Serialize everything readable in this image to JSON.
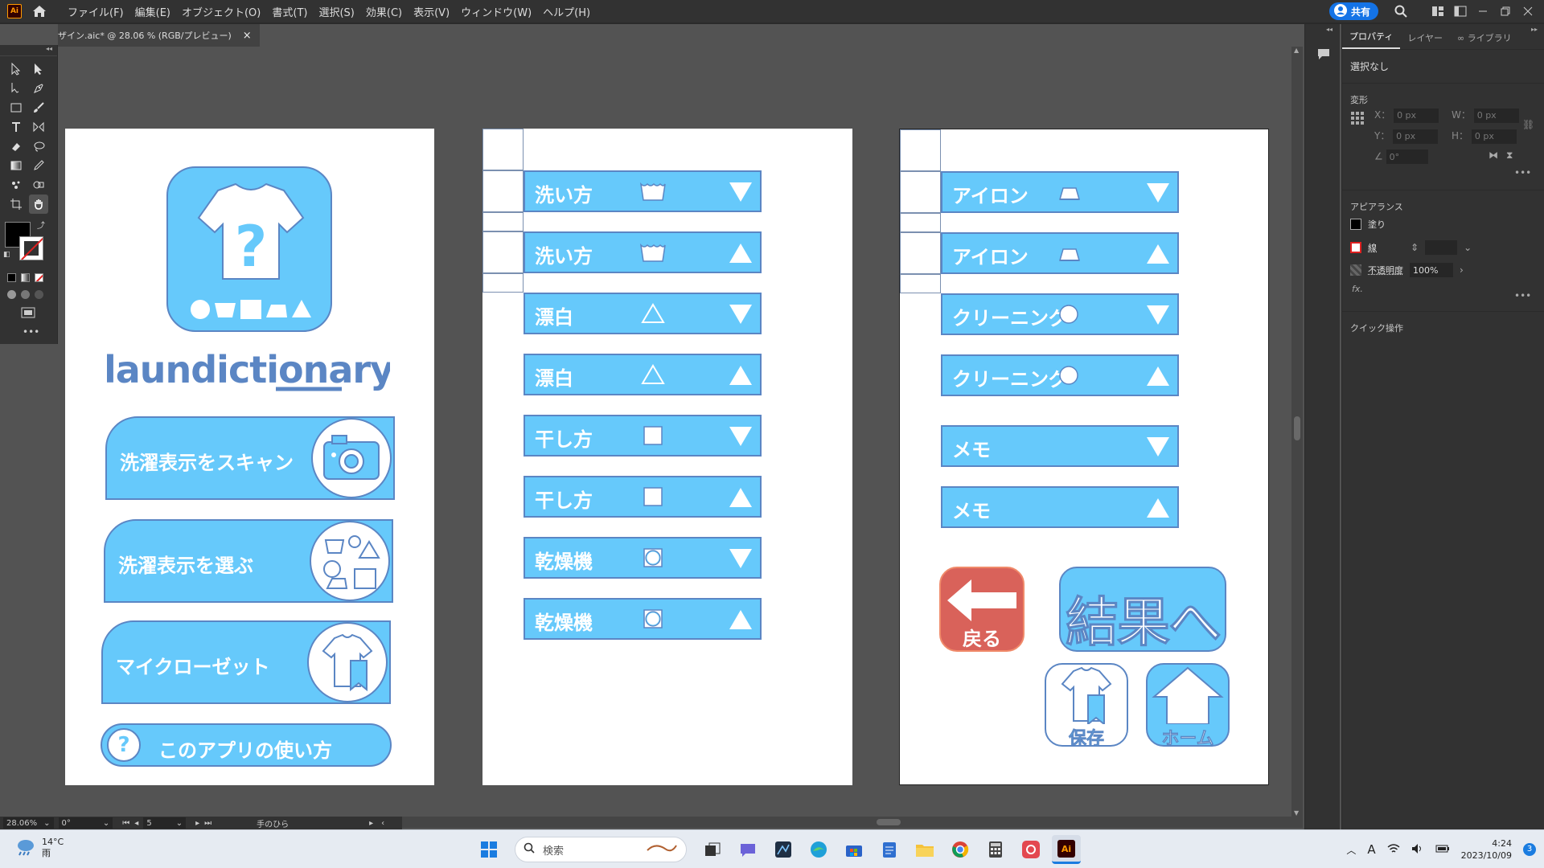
{
  "app": {
    "logo_text": "Ai",
    "menu": [
      "ファイル(F)",
      "編集(E)",
      "オブジェクト(O)",
      "書式(T)",
      "選択(S)",
      "効果(C)",
      "表示(V)",
      "ウィンドウ(W)",
      "ヘルプ(H)"
    ],
    "share_label": "共有"
  },
  "document_tab": {
    "title": "ザイン.aic* @ 28.06 % (RGB/プレビュー)",
    "close": "×"
  },
  "status": {
    "zoom": "28.06%",
    "angle": "0°",
    "artboard": "5",
    "tool_name": "手のひら"
  },
  "properties": {
    "tabs": [
      "プロパティ",
      "レイヤー",
      "ライブラリ"
    ],
    "selection": "選択なし",
    "transform_title": "変形",
    "x_label": "X：",
    "y_label": "Y：",
    "w_label": "W：",
    "h_label": "H：",
    "x_value": "0 px",
    "y_value": "0 px",
    "w_value": "0 px",
    "h_value": "0 px",
    "angle_value": "0°",
    "appearance_title": "アピアランス",
    "fill_label": "塗り",
    "stroke_label": "線",
    "opacity_label": "不透明度",
    "opacity_value": "100%",
    "fx_label": "fx.",
    "quick_actions_title": "クイック操作"
  },
  "artboard1": {
    "logo_text": "laundictionary",
    "buttons": [
      {
        "label": "洗濯表示をスキャン",
        "icon": "camera-icon"
      },
      {
        "label": "洗濯表示を選ぶ",
        "icon": "care-symbols-icon"
      },
      {
        "label": "マイクローゼット",
        "icon": "closet-shirt-icon"
      }
    ],
    "help_label": "このアプリの使い方",
    "help_icon_text": "?"
  },
  "artboard2": {
    "bars": [
      {
        "label": "洗い方",
        "symbol": "wash-tub-icon",
        "arrow": "down"
      },
      {
        "label": "洗い方",
        "symbol": "wash-tub-icon",
        "arrow": "up"
      },
      {
        "label": "漂白",
        "symbol": "triangle-icon",
        "arrow": "down"
      },
      {
        "label": "漂白",
        "symbol": "triangle-icon",
        "arrow": "up"
      },
      {
        "label": "干し方",
        "symbol": "square-icon",
        "arrow": "down"
      },
      {
        "label": "干し方",
        "symbol": "square-icon",
        "arrow": "up"
      },
      {
        "label": "乾燥機",
        "symbol": "dryer-icon",
        "arrow": "down"
      },
      {
        "label": "乾燥機",
        "symbol": "dryer-icon",
        "arrow": "up"
      }
    ]
  },
  "artboard3": {
    "bars": [
      {
        "label": "アイロン",
        "symbol": "iron-icon",
        "arrow": "down"
      },
      {
        "label": "アイロン",
        "symbol": "iron-icon",
        "arrow": "up"
      },
      {
        "label": "クリーニング",
        "symbol": "circle-icon",
        "arrow": "down"
      },
      {
        "label": "クリーニング",
        "symbol": "circle-icon",
        "arrow": "up"
      },
      {
        "label": "メモ",
        "symbol": "",
        "arrow": "down"
      },
      {
        "label": "メモ",
        "symbol": "",
        "arrow": "up"
      }
    ],
    "back_label": "戻る",
    "result_label": "結果へ",
    "save_label": "保存",
    "home_label": "ホーム"
  },
  "taskbar": {
    "temperature": "14°C",
    "weather": "雨",
    "search_placeholder": "検索",
    "time": "4:24",
    "date": "2023/10/09",
    "ime": "A",
    "notification_count": "3"
  },
  "colors": {
    "ui_dark": "#323232",
    "canvas": "#535353",
    "design_blue": "#66c9fb",
    "design_outline": "#5b86c4",
    "back_red": "#d9625a",
    "share_blue": "#1473e6"
  }
}
